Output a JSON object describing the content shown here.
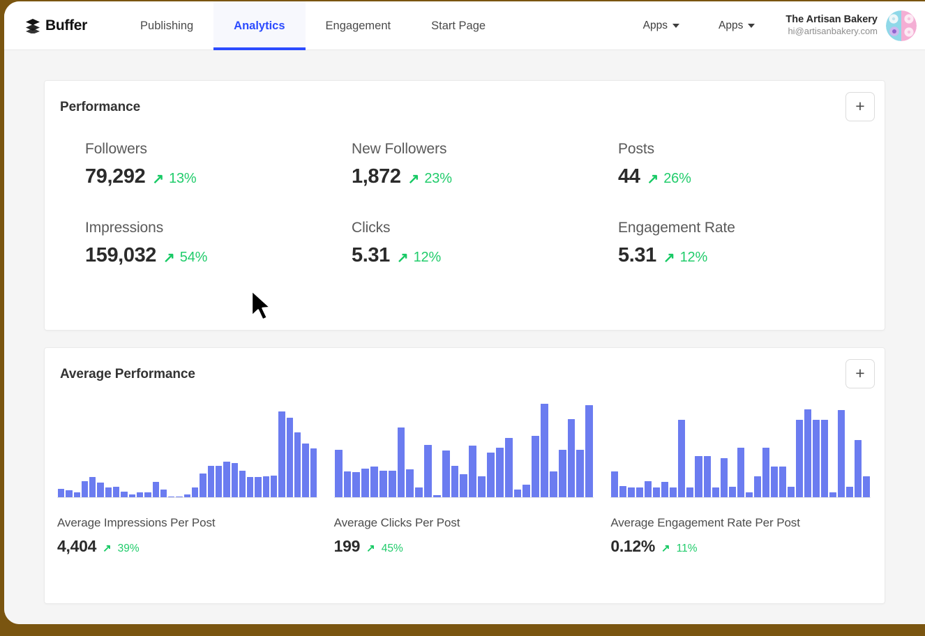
{
  "brand": {
    "name": "Buffer",
    "icon": "layers-icon"
  },
  "nav": {
    "tabs": [
      {
        "label": "Publishing",
        "active": false
      },
      {
        "label": "Analytics",
        "active": true
      },
      {
        "label": "Engagement",
        "active": false
      },
      {
        "label": "Start Page",
        "active": false
      }
    ],
    "apps_menus": [
      {
        "label": "Apps"
      },
      {
        "label": "Apps"
      }
    ]
  },
  "account": {
    "name": "The Artisan Bakery",
    "email": "hi@artisanbakery.com",
    "avatar_alt": "artisan-bakery-avatar"
  },
  "performance": {
    "title": "Performance",
    "add_button": "+",
    "metrics": [
      {
        "label": "Followers",
        "value": "79,292",
        "arrow": "↗",
        "change": "13%"
      },
      {
        "label": "New Followers",
        "value": "1,872",
        "arrow": "↗",
        "change": "23%"
      },
      {
        "label": "Posts",
        "value": "44",
        "arrow": "↗",
        "change": "26%"
      },
      {
        "label": "Impressions",
        "value": "159,032",
        "arrow": "↗",
        "change": "54%"
      },
      {
        "label": "Clicks",
        "value": "5.31",
        "arrow": "↗",
        "change": "12%"
      },
      {
        "label": "Engagement Rate",
        "value": "5.31",
        "arrow": "↗",
        "change": "12%"
      }
    ]
  },
  "average_performance": {
    "title": "Average Performance",
    "add_button": "+",
    "charts": [
      {
        "label": "Average Impressions Per Post",
        "value": "4,404",
        "arrow": "↗",
        "change": "39%"
      },
      {
        "label": "Average Clicks Per Post",
        "value": "199",
        "arrow": "↗",
        "change": "45%"
      },
      {
        "label": "Average Engagement Rate Per Post",
        "value": "0.12%",
        "arrow": "↗",
        "change": "11%"
      }
    ]
  },
  "colors": {
    "accent": "#2c4bff",
    "bar": "#6b7cf0",
    "positive": "#21cc6b",
    "page_bg": "#f5f5f5",
    "desktop_bg": "#7a5510"
  },
  "chart_data": [
    {
      "type": "bar",
      "title": "Average Impressions Per Post",
      "xlabel": "",
      "ylabel": "",
      "grid": false,
      "legend": null,
      "ylim": [
        0,
        100
      ],
      "categories": [
        "1",
        "2",
        "3",
        "4",
        "5",
        "6",
        "7",
        "8",
        "9",
        "10",
        "11",
        "12",
        "13",
        "14",
        "15",
        "16",
        "17",
        "18",
        "19",
        "20",
        "21",
        "22",
        "23",
        "24",
        "25",
        "26",
        "27",
        "28",
        "29",
        "30",
        "31",
        "32",
        "33"
      ],
      "values": [
        9,
        7,
        5,
        17,
        21,
        15,
        10,
        11,
        6,
        3,
        5,
        5,
        16,
        8,
        1,
        0,
        3,
        10,
        25,
        33,
        33,
        37,
        36,
        28,
        21,
        21,
        22,
        23,
        90,
        83,
        68,
        56,
        51
      ]
    },
    {
      "type": "bar",
      "title": "Average Clicks Per Post",
      "xlabel": "",
      "ylabel": "",
      "grid": false,
      "legend": null,
      "ylim": [
        0,
        100
      ],
      "categories": [
        "1",
        "2",
        "3",
        "4",
        "5",
        "6",
        "7",
        "8",
        "9",
        "10",
        "11",
        "12",
        "13",
        "14",
        "15",
        "16",
        "17",
        "18",
        "19",
        "20",
        "21",
        "22",
        "23",
        "24",
        "25",
        "26",
        "27",
        "28",
        "29"
      ],
      "values": [
        50,
        27,
        26,
        30,
        32,
        28,
        28,
        73,
        29,
        10,
        55,
        2,
        49,
        33,
        24,
        54,
        22,
        47,
        52,
        62,
        8,
        13,
        64,
        98,
        27,
        50,
        82,
        50,
        96
      ]
    },
    {
      "type": "bar",
      "title": "Average Engagement Rate Per Post",
      "xlabel": "",
      "ylabel": "",
      "grid": false,
      "legend": null,
      "ylim": [
        0,
        100
      ],
      "categories": [
        "1",
        "2",
        "3",
        "4",
        "5",
        "6",
        "7",
        "8",
        "9",
        "10",
        "11",
        "12",
        "13",
        "14",
        "15",
        "16",
        "17",
        "18",
        "19",
        "20",
        "21",
        "22",
        "23",
        "24",
        "25",
        "26"
      ],
      "values": [
        27,
        12,
        10,
        10,
        17,
        10,
        16,
        10,
        81,
        10,
        43,
        43,
        10,
        41,
        11,
        52,
        5,
        22,
        52,
        32,
        32,
        11,
        81,
        92,
        81,
        81
      ]
    }
  ],
  "chart_data_extra": {
    "chart3_tail": [
      5,
      91,
      11,
      60,
      22
    ]
  }
}
